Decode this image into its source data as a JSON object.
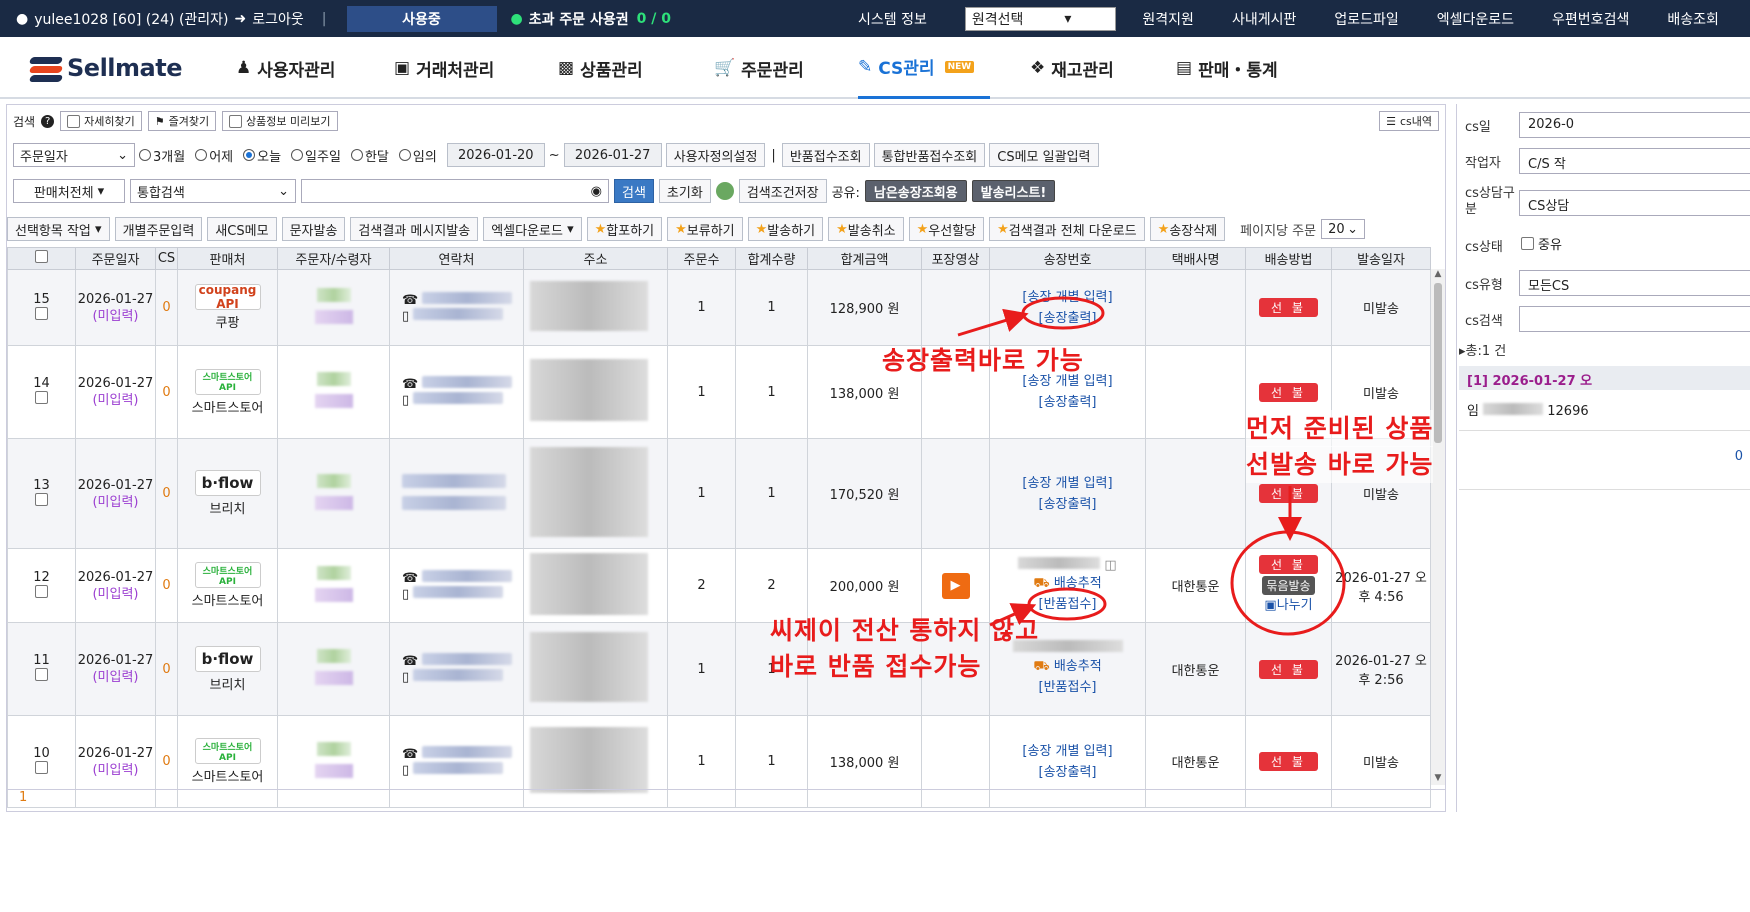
{
  "topbar": {
    "user": "yulee1028 [60] (24) (관리자)",
    "logout": "로그아웃",
    "status": "사용중",
    "quota_label": "초과 주문 사용권",
    "quota_value": "0 / 0",
    "menu": [
      "시스템 정보",
      "원격선택",
      "원격지원",
      "사내게시판",
      "업로드파일",
      "엑셀다운로드",
      "우편번호검색",
      "배송조회"
    ]
  },
  "nav": {
    "logo": "Sellmate",
    "items": [
      "사용자관리",
      "거래처관리",
      "상품관리",
      "주문관리",
      "CS관리",
      "재고관리",
      "판매・통계"
    ],
    "active": "CS관리",
    "new_badge": "NEW"
  },
  "search": {
    "label": "검색",
    "detail": "자세히찾기",
    "favorite": "즐겨찾기",
    "preview": "상품정보 미리보기",
    "cs_list": "cs내역",
    "date_type": "주문일자",
    "periods": [
      "3개월",
      "어제",
      "오늘",
      "일주일",
      "한달",
      "임의"
    ],
    "selected_period": "오늘",
    "date_from": "2026-01-20",
    "date_to": "2026-01-27",
    "user_setting": "사용자정의설정",
    "btn_return": "반품접수조회",
    "btn_integrated_return": "통합반품접수조회",
    "btn_cs_memo": "CS메모 일괄입력",
    "seller_all": "판매처전체",
    "search_type": "통합검색",
    "search_btn": "검색",
    "reset_btn": "초기화",
    "save_cond": "검색조건저장",
    "share_label": "공유:",
    "share1": "남은송장조회용",
    "share2": "발송리스트!"
  },
  "actions": {
    "select_action": "선택항목 작업",
    "individual_order": "개별주문입력",
    "new_cs": "새CS메모",
    "sms": "문자발송",
    "search_msg": "검색결과 메시지발송",
    "excel": "엑셀다운로드",
    "combine": "합포하기",
    "hold": "보류하기",
    "ship": "발송하기",
    "cancel_ship": "발송취소",
    "priority": "우선할당",
    "all_download": "검색결과 전체 다운로드",
    "delete_invoice": "송장삭제",
    "per_page_label": "페이지당 주문",
    "per_page": "20"
  },
  "table": {
    "headers": [
      "주문일자",
      "CS",
      "판매처",
      "주문자/수령자",
      "연락처",
      "주소",
      "주문수",
      "합계수량",
      "합계금액",
      "포장영상",
      "송장번호",
      "택배사명",
      "배송방법",
      "발송일자"
    ],
    "rows": [
      {
        "no": "15",
        "date": "2026-01-27",
        "status": "(미입력)",
        "cs": "0",
        "seller_logo": "coupang API",
        "seller": "쿠팡",
        "orders": "1",
        "qty": "1",
        "amount": "128,900 원",
        "video": false,
        "invoice": [
          "[송장 개별 입력]",
          "[송장출력]"
        ],
        "courier": "",
        "method": "선 불",
        "ship_date": "미발송"
      },
      {
        "no": "14",
        "date": "2026-01-27",
        "status": "(미입력)",
        "cs": "0",
        "seller_logo": "스마트스토어 API",
        "seller": "스마트스토어",
        "orders": "1",
        "qty": "1",
        "amount": "138,000 원",
        "video": false,
        "invoice": [
          "[송장 개별 입력]",
          "[송장출력]"
        ],
        "courier": "",
        "method": "선 불",
        "ship_date": "미발송"
      },
      {
        "no": "13",
        "date": "2026-01-27",
        "status": "(미입력)",
        "cs": "0",
        "seller_logo": "b·flow",
        "seller": "브리치",
        "orders": "1",
        "qty": "1",
        "amount": "170,520 원",
        "video": false,
        "invoice": [
          "[송장 개별 입력]",
          "[송장출력]"
        ],
        "courier": "",
        "method": "선 불",
        "ship_date": "미발송"
      },
      {
        "no": "12",
        "date": "2026-01-27",
        "status": "(미입력)",
        "cs": "0",
        "seller_logo": "스마트스토어 API",
        "seller": "스마트스토어",
        "orders": "2",
        "qty": "2",
        "amount": "200,000 원",
        "video": true,
        "invoice": [
          "배송추적",
          "[반품접수]"
        ],
        "courier": "대한통운",
        "method": "선 불",
        "extra": [
          "묶음발송",
          "나누기"
        ],
        "ship_date": "2026-01-27 오후 4:56"
      },
      {
        "no": "11",
        "date": "2026-01-27",
        "status": "(미입력)",
        "cs": "0",
        "seller_logo": "b·flow",
        "seller": "브리치",
        "orders": "1",
        "qty": "1",
        "amount": "",
        "video": false,
        "invoice": [
          "배송추적",
          "[반품접수]"
        ],
        "courier": "대한통운",
        "method": "선 불",
        "ship_date": "2026-01-27 오후 2:56"
      },
      {
        "no": "10",
        "date": "2026-01-27",
        "status": "(미입력)",
        "cs": "0",
        "seller_logo": "스마트스토어 API",
        "seller": "스마트스토어",
        "orders": "1",
        "qty": "1",
        "amount": "138,000 원",
        "video": false,
        "invoice": [
          "[송장 개별 입력]",
          "[송장출력]"
        ],
        "courier": "대한통운",
        "method": "선 불",
        "ship_date": "미발송"
      }
    ],
    "page": "1"
  },
  "annotations": {
    "a1": "송장출력바로 가능",
    "a2_line1": "먼저 준비된 상품",
    "a2_line2": "선발송 바로 가능",
    "a3_line1": "씨제이 전산 통하지 않고",
    "a3_line2": "바로 반품 접수가능"
  },
  "side": {
    "cs_date_label": "cs일",
    "cs_date_value": "2026-0",
    "worker_label": "작업자",
    "worker_value": "C/S 작",
    "cs_cat_label": "cs상담구분",
    "cs_cat_value": "CS상담",
    "cs_status_label": "cs상태",
    "cs_status_value": "중유",
    "cs_type_label": "cs유형",
    "cs_type_value": "모든CS",
    "cs_search_label": "cs검색",
    "total": "총:1 건",
    "entry_head": "[1] 2026-01-27 오",
    "entry_sub": "임",
    "entry_num": "12696",
    "entry_num2": "0"
  }
}
